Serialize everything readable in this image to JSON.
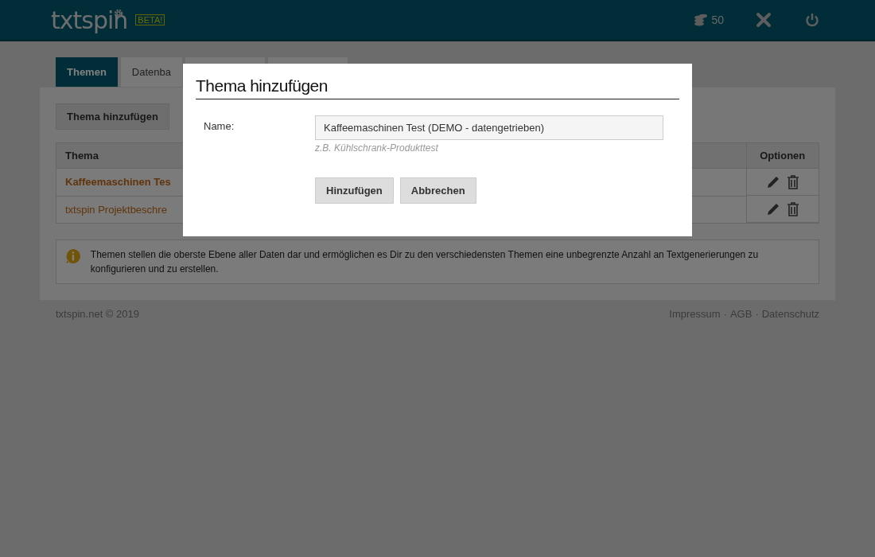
{
  "header": {
    "logo": "txtspin",
    "badge": "BETA!",
    "credits": "50"
  },
  "tabs": [
    {
      "label": "Themen",
      "selected": true
    },
    {
      "label": "Datenba",
      "selected": false
    },
    {
      "selected": false
    },
    {
      "selected": false
    }
  ],
  "toolbar": {
    "add_button": "Thema hinzufügen"
  },
  "table": {
    "columns": [
      "Thema",
      "Optionen"
    ],
    "rows": [
      {
        "title": "Kaffeemaschinen Tes",
        "highlighted": true
      },
      {
        "title": "txtspin Projektbeschre",
        "highlighted": false
      }
    ]
  },
  "info": "Themen stellen die oberste Ebene aller Daten dar und ermöglichen es Dir zu den verschiedensten Themen eine unbegrenzte Anzahl an Textgenerierungen zu konfigurieren und zu erstellen.",
  "footer": {
    "copyright": "txtspin.net © 2019",
    "links": [
      "Impressum",
      "AGB",
      "Datenschutz"
    ],
    "separator": "·"
  },
  "dialog": {
    "title": "Thema hinzufügen",
    "label": "Name:",
    "value": "Kaffeemaschinen Test (DEMO - datengetrieben)",
    "hint": "z.B. Kühlschrank-Produkttest",
    "buttons": [
      "Hinzufügen",
      "Abbrechen"
    ]
  }
}
